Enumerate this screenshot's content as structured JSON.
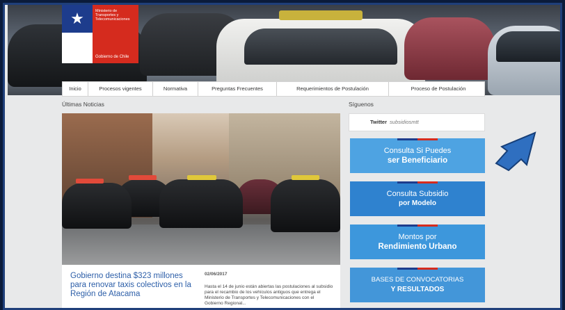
{
  "header": {
    "ministry_lines": [
      "Ministerio de",
      "Transportes y",
      "Telecomunicaciones"
    ],
    "government": "Gobierno de Chile"
  },
  "nav": {
    "items": [
      "Inicio",
      "Procesos vigentes",
      "Normativa",
      "Preguntas Frecuentes",
      "Requerimientos de Postulación",
      "Proceso de Postulación"
    ]
  },
  "news": {
    "section_label": "Últimas Noticias",
    "title": "Gobierno destina $323 millones para renovar taxis colectivos en la Región de Atacama",
    "date": "02/06/2017",
    "body": "Hasta el 14 de junio están abiertas las postulaciones al subsidio para el recambio de los vehículos antiguos que entrega el Ministerio de Transportes y Telecomunicaciones con el Gobierno Regional..."
  },
  "social": {
    "section_label": "Síguenos",
    "twitter_label": "Twitter",
    "twitter_handle": "subsidiosmtt"
  },
  "cta": [
    {
      "line1": "Consulta Si Puedes",
      "line2": "ser Beneficiario"
    },
    {
      "line1": "Consulta Subsidio",
      "line2": "por Modelo"
    },
    {
      "line1": "Montos por",
      "line2": "Rendimiento Urbano"
    },
    {
      "line1": "BASES DE CONVOCATORIAS",
      "line2": "Y RESULTADOS"
    }
  ],
  "colors": {
    "accent_blue": "#3f8fd2",
    "brand_blue": "#1d3c8c",
    "brand_red": "#d52b1e",
    "link_blue": "#2c5ea8"
  },
  "annotation_icon": "arrow-icon"
}
